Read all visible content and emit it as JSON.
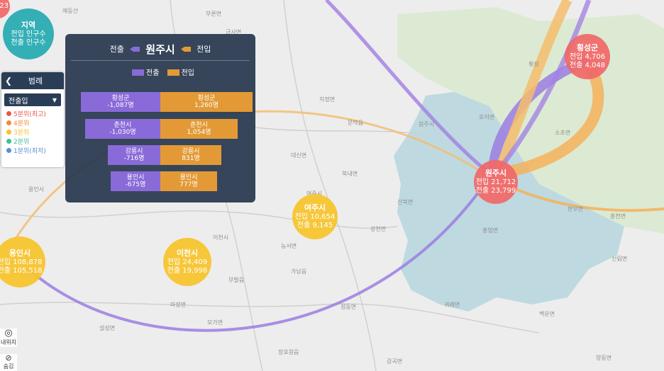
{
  "map": {
    "labels": [
      "애등산",
      "부론면",
      "원주시",
      "용인시",
      "이천시",
      "여주시",
      "강천면",
      "귀래면",
      "지정면",
      "문막읍",
      "호저면",
      "횡성",
      "흥업면",
      "소초면",
      "판부면",
      "신림면",
      "백운면",
      "대신면",
      "북내면",
      "가남읍",
      "점동면",
      "부발읍",
      "마장면",
      "모가면",
      "설성면",
      "장호원읍",
      "감곡면",
      "산북면",
      "금사면",
      "흥천면",
      "능서면",
      "양동면"
    ],
    "bubbles": [
      {
        "id": "wonju",
        "name": "원주시",
        "line1": "전입 21,712",
        "line2": "전출 23,799",
        "color": "salmon"
      },
      {
        "id": "hoengseong",
        "name": "횡성군",
        "line1": "전입 4,706",
        "line2": "전출 4,048",
        "color": "salmon"
      },
      {
        "id": "yeoju",
        "name": "여주시",
        "line1": "전입 10,654",
        "line2": "전출 9,145",
        "color": "yellow"
      },
      {
        "id": "icheon",
        "name": "이천시",
        "line1": "전입 24,409",
        "line2": "전출 19,998",
        "color": "yellow"
      },
      {
        "id": "yongin",
        "name": "용인시",
        "line1": "전입 108,878",
        "line2": "전출 105,518",
        "color": "yellow"
      },
      {
        "id": "region",
        "name": "지역",
        "line1": "전입 인구수",
        "line2": "전출 인구수",
        "color": "teal"
      },
      {
        "id": "partial",
        "name": "",
        "line1": "23",
        "line2": "",
        "color": "salmon"
      }
    ]
  },
  "popup": {
    "title": "원주시",
    "out_label": "전출",
    "in_label": "전입",
    "legend_out": "전출",
    "legend_in": "전입",
    "rows": [
      {
        "name": "횡성군",
        "out_text": "-1,087명",
        "in_text": "1,260명",
        "out": 1087,
        "in": 1260
      },
      {
        "name": "춘천시",
        "out_text": "-1,030명",
        "in_text": "1,054명",
        "out": 1030,
        "in": 1054
      },
      {
        "name": "강릉시",
        "out_text": "-716명",
        "in_text": "831명",
        "out": 716,
        "in": 831
      },
      {
        "name": "용인시",
        "out_text": "-675명",
        "in_text": "777명",
        "out": 675,
        "in": 777
      }
    ]
  },
  "legend": {
    "title": "범례",
    "select": "전출입",
    "items": [
      {
        "label": "5분위(최고)",
        "color": "#e5584f"
      },
      {
        "label": "4분위",
        "color": "#ef8a3c"
      },
      {
        "label": "3분위",
        "color": "#f5c32c"
      },
      {
        "label": "2분위",
        "color": "#3fbf9a"
      },
      {
        "label": "1분위(최저)",
        "color": "#5b8fd6"
      }
    ]
  },
  "controls": {
    "locate": "내위치",
    "hide": "숨김"
  },
  "colors": {
    "out": "#8a6ad8",
    "in": "#e39a36",
    "panel": "#28384e"
  }
}
